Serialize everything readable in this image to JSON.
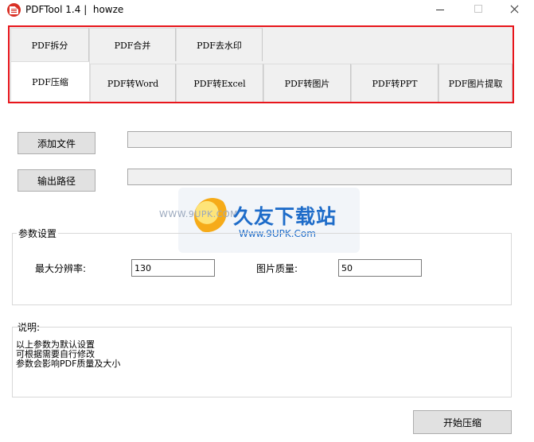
{
  "window": {
    "title": "PDFTool 1.4 |  howze"
  },
  "tabs": {
    "row1": [
      {
        "label": "PDF拆分"
      },
      {
        "label": "PDF合并"
      },
      {
        "label": "PDF去水印"
      }
    ],
    "row2": [
      {
        "label": "PDF压缩",
        "active": true
      },
      {
        "label": "PDF转Word"
      },
      {
        "label": "PDF转Excel"
      },
      {
        "label": "PDF转图片"
      },
      {
        "label": "PDF转PPT"
      },
      {
        "label": "PDF图片提取"
      }
    ]
  },
  "actions": {
    "add_file_label": "添加文件",
    "output_path_label": "输出路径",
    "start_label": "开始压缩"
  },
  "paths": {
    "input_file": "",
    "output_path": ""
  },
  "settings": {
    "group_label": "参数设置",
    "max_resolution_label": "最大分辨率:",
    "max_resolution_value": "130",
    "image_quality_label": "图片质量:",
    "image_quality_value": "50"
  },
  "description": {
    "label": "说明:",
    "lines": [
      "以上参数为默认设置",
      "可根据需要自行修改",
      "参数会影响PDF质量及大小"
    ]
  },
  "watermark": {
    "small_text": "WWW.9UPK.COM",
    "brand": "久友下载站",
    "url": "Www.9UPK.Com"
  }
}
